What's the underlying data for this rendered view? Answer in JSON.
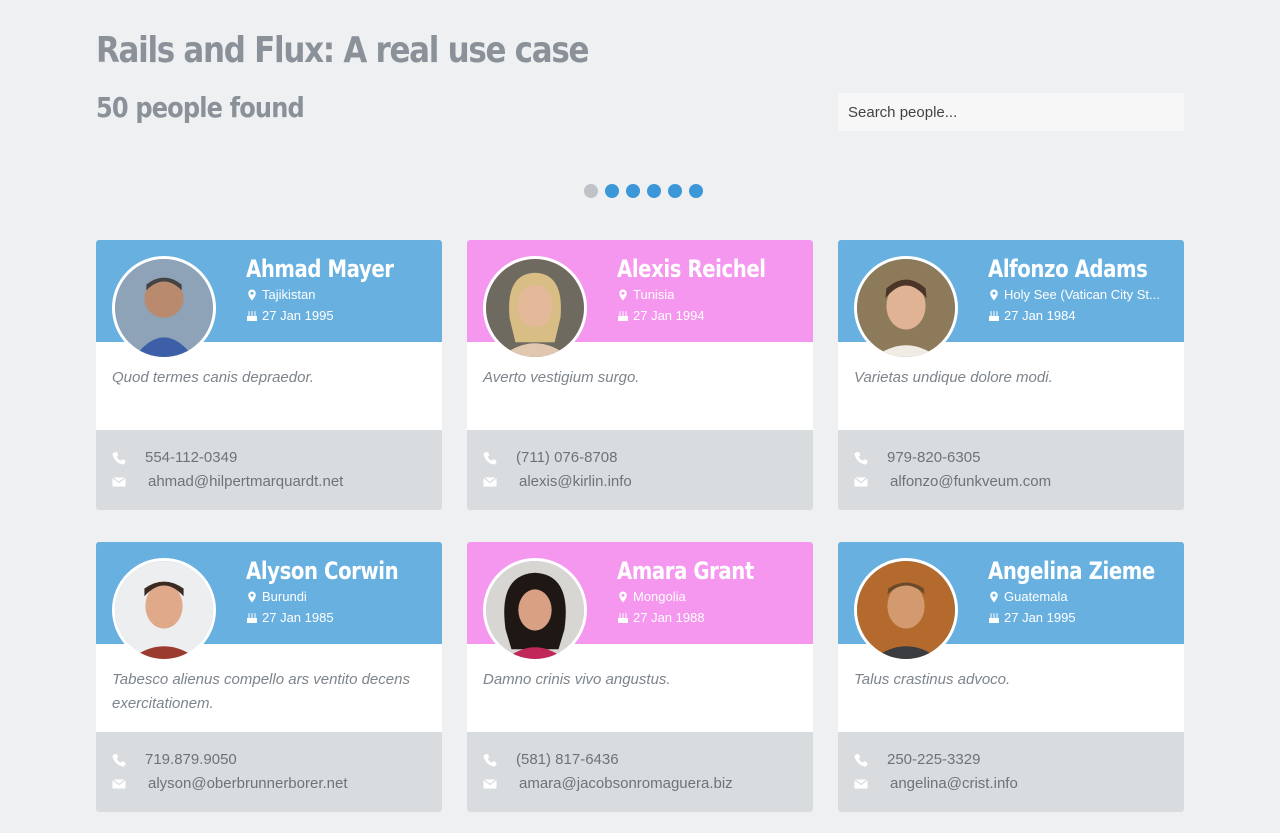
{
  "header": {
    "title": "Rails and Flux: A real use case",
    "count": "50 people found"
  },
  "search": {
    "placeholder": "Search people..."
  },
  "pagination": {
    "pages": 6,
    "active": 1
  },
  "colors": {
    "blue": "#68b0e0",
    "pink": "#f597ef",
    "dot": "#3b97d8",
    "dot_active": "#bfc3c7"
  },
  "people": [
    {
      "name": "Ahmad Mayer",
      "location": "Tajikistan",
      "birthday": "27 Jan 1995",
      "quote": "Quod termes canis depraedor.",
      "phone": "554-112-0349",
      "email": "ahmad@hilpertmarquardt.net",
      "theme": "blue"
    },
    {
      "name": "Alexis Reichel",
      "location": "Tunisia",
      "birthday": "27 Jan 1994",
      "quote": "Averto vestigium surgo.",
      "phone": "(711) 076-8708",
      "email": "alexis@kirlin.info",
      "theme": "pink"
    },
    {
      "name": "Alfonzo Adams",
      "location": "Holy See (Vatican City St...",
      "birthday": "27 Jan 1984",
      "quote": "Varietas undique dolore modi.",
      "phone": "979-820-6305",
      "email": "alfonzo@funkveum.com",
      "theme": "blue"
    },
    {
      "name": "Alyson Corwin",
      "location": "Burundi",
      "birthday": "27 Jan 1985",
      "quote": "Tabesco alienus compello ars ventito decens exercitationem.",
      "phone": "719.879.9050",
      "email": "alyson@oberbrunnerborer.net",
      "theme": "blue"
    },
    {
      "name": "Amara Grant",
      "location": "Mongolia",
      "birthday": "27 Jan 1988",
      "quote": "Damno crinis vivo angustus.",
      "phone": "(581) 817-6436",
      "email": "amara@jacobsonromaguera.biz",
      "theme": "pink"
    },
    {
      "name": "Angelina Zieme",
      "location": "Guatemala",
      "birthday": "27 Jan 1995",
      "quote": "Talus crastinus advoco.",
      "phone": "250-225-3329",
      "email": "angelina@crist.info",
      "theme": "blue"
    }
  ]
}
